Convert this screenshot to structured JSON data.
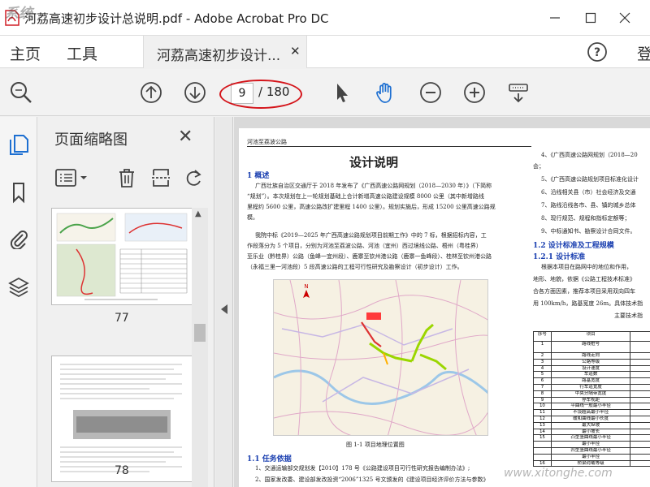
{
  "window": {
    "title": "河荔高速初步设计总说明.pdf - Adobe Acrobat Pro DC",
    "minimize_icon": "minimize-icon",
    "maximize_icon": "maximize-icon",
    "close_icon": "close-icon"
  },
  "menu": {
    "home": "主页",
    "tools": "工具",
    "tab_label": "河荔高速初步设计...",
    "help_icon": "help-icon",
    "login_partial": "登"
  },
  "toolbar": {
    "current_page": "9",
    "total_pages": "/ 180",
    "icons": [
      "zoom-search-icon",
      "page-up-icon",
      "page-down-icon",
      "select-cursor-icon",
      "hand-tool-icon",
      "zoom-out-icon",
      "zoom-in-icon",
      "keyboard-scroll-icon"
    ]
  },
  "panel": {
    "title": "页面缩略图",
    "thumbs": [
      {
        "page": "77"
      },
      {
        "page": "78"
      }
    ]
  },
  "document": {
    "header": "河池至荔波公路",
    "title": "设计说明",
    "sec1": "1  概述",
    "para1": [
      "广西壮族自治区交通厅于 2018 年发布了《广西高速公路网规划（2018—2030 年）》（下简称",
      "“规划”）。本次规划在上一轮规划基础上合计新增高速公路建设规模 8000 公里（其中新增路线",
      "里程约 5600 公里，高速公路改扩建里程 1400 公里）。规划实施后，形成 15200 公里高速公路规",
      "模。"
    ],
    "para2": [
      "我院中标《2019—2025 年广西高速公路规划项目前期工作》中的 7 标，根据招标内容，工",
      "作段落分为 5 个项目，分别为河池至荔波公路、河池（宜州）西过境线公路、梧州（粤桂界）",
      "至乐业（黔桂界）公路（鱼峰一宜州段）、鹿寨至钦州港公路（鹿寨一鱼峰段）、桂林至钦州港公路",
      "（永福三里一河池段）5 段高速公路的工程可行性研究及勘察设计（初步设计）工作。"
    ],
    "map_caption": "图 1-1 项目地理位置图",
    "sec11": "1.1 任务依据",
    "list1": "1、交通运输部交规划发【2010】178 号《公路建设项目可行性研究报告编制办法》;",
    "list2": "2、国家发改委、建设部发改投资“2006”1325 号文颁发的《建设项目经济评价方法与参数》",
    "right_col": [
      "4、《广西高速公路网规划（2018—20",
      "会；",
      "5、《广西高速公路规划项目标准化设计",
      "6、沿线相关县（市）社会经济及交通",
      "7、路线沿线各市、县、镇的城乡总体",
      "8、现行规范、规程和指标定额等；",
      "9、中标通知书、勘察设计合同文件。"
    ],
    "sec12": "1.2 设计标准及工程规模",
    "sec121": "1.2.1    设计标准",
    "para3": [
      "根据本项目在路网中的地位和作用，",
      "地形、地貌，依据《公路工程技术标准》",
      "合各方面因素，推荐本项目采用双向四车",
      "用 100km/h，路基宽度 26m。具体技术指"
    ],
    "table_caption": "主要技术指",
    "table_header": [
      "序号",
      "项目",
      ""
    ],
    "table_rows": [
      [
        "1",
        "路线桩号",
        ""
      ],
      [
        "2",
        "路线走向",
        ""
      ],
      [
        "3",
        "公路等级",
        ""
      ],
      [
        "4",
        "设计速度",
        ""
      ],
      [
        "5",
        "车道数",
        ""
      ],
      [
        "6",
        "路基宽度",
        ""
      ],
      [
        "7",
        "行车道宽度",
        ""
      ],
      [
        "8",
        "中央分隔带宽度",
        ""
      ],
      [
        "9",
        "停车视距",
        ""
      ],
      [
        "10",
        "平曲线一般最小半径",
        ""
      ],
      [
        "11",
        "不设超高最小半径",
        ""
      ],
      [
        "12",
        "缓和曲线最小长度",
        ""
      ],
      [
        "13",
        "最大纵坡",
        ""
      ],
      [
        "14",
        "最小坡长",
        ""
      ],
      [
        "15",
        "凸型竖曲线最小半径",
        "一般"
      ],
      [
        "",
        "最小半径",
        "极限"
      ],
      [
        "",
        "凹型竖曲线最小半径",
        "一般"
      ],
      [
        "",
        "最小半径",
        "极限"
      ],
      [
        "16",
        "桥梁荷载等级",
        ""
      ]
    ]
  },
  "watermarks": {
    "top_left": "系统",
    "bottom_right": "www.xitonghe.com"
  },
  "colors": {
    "accent_blue": "#1a3fb0",
    "annotation_red": "#d4141a",
    "acrobat_red": "#d01f26"
  }
}
